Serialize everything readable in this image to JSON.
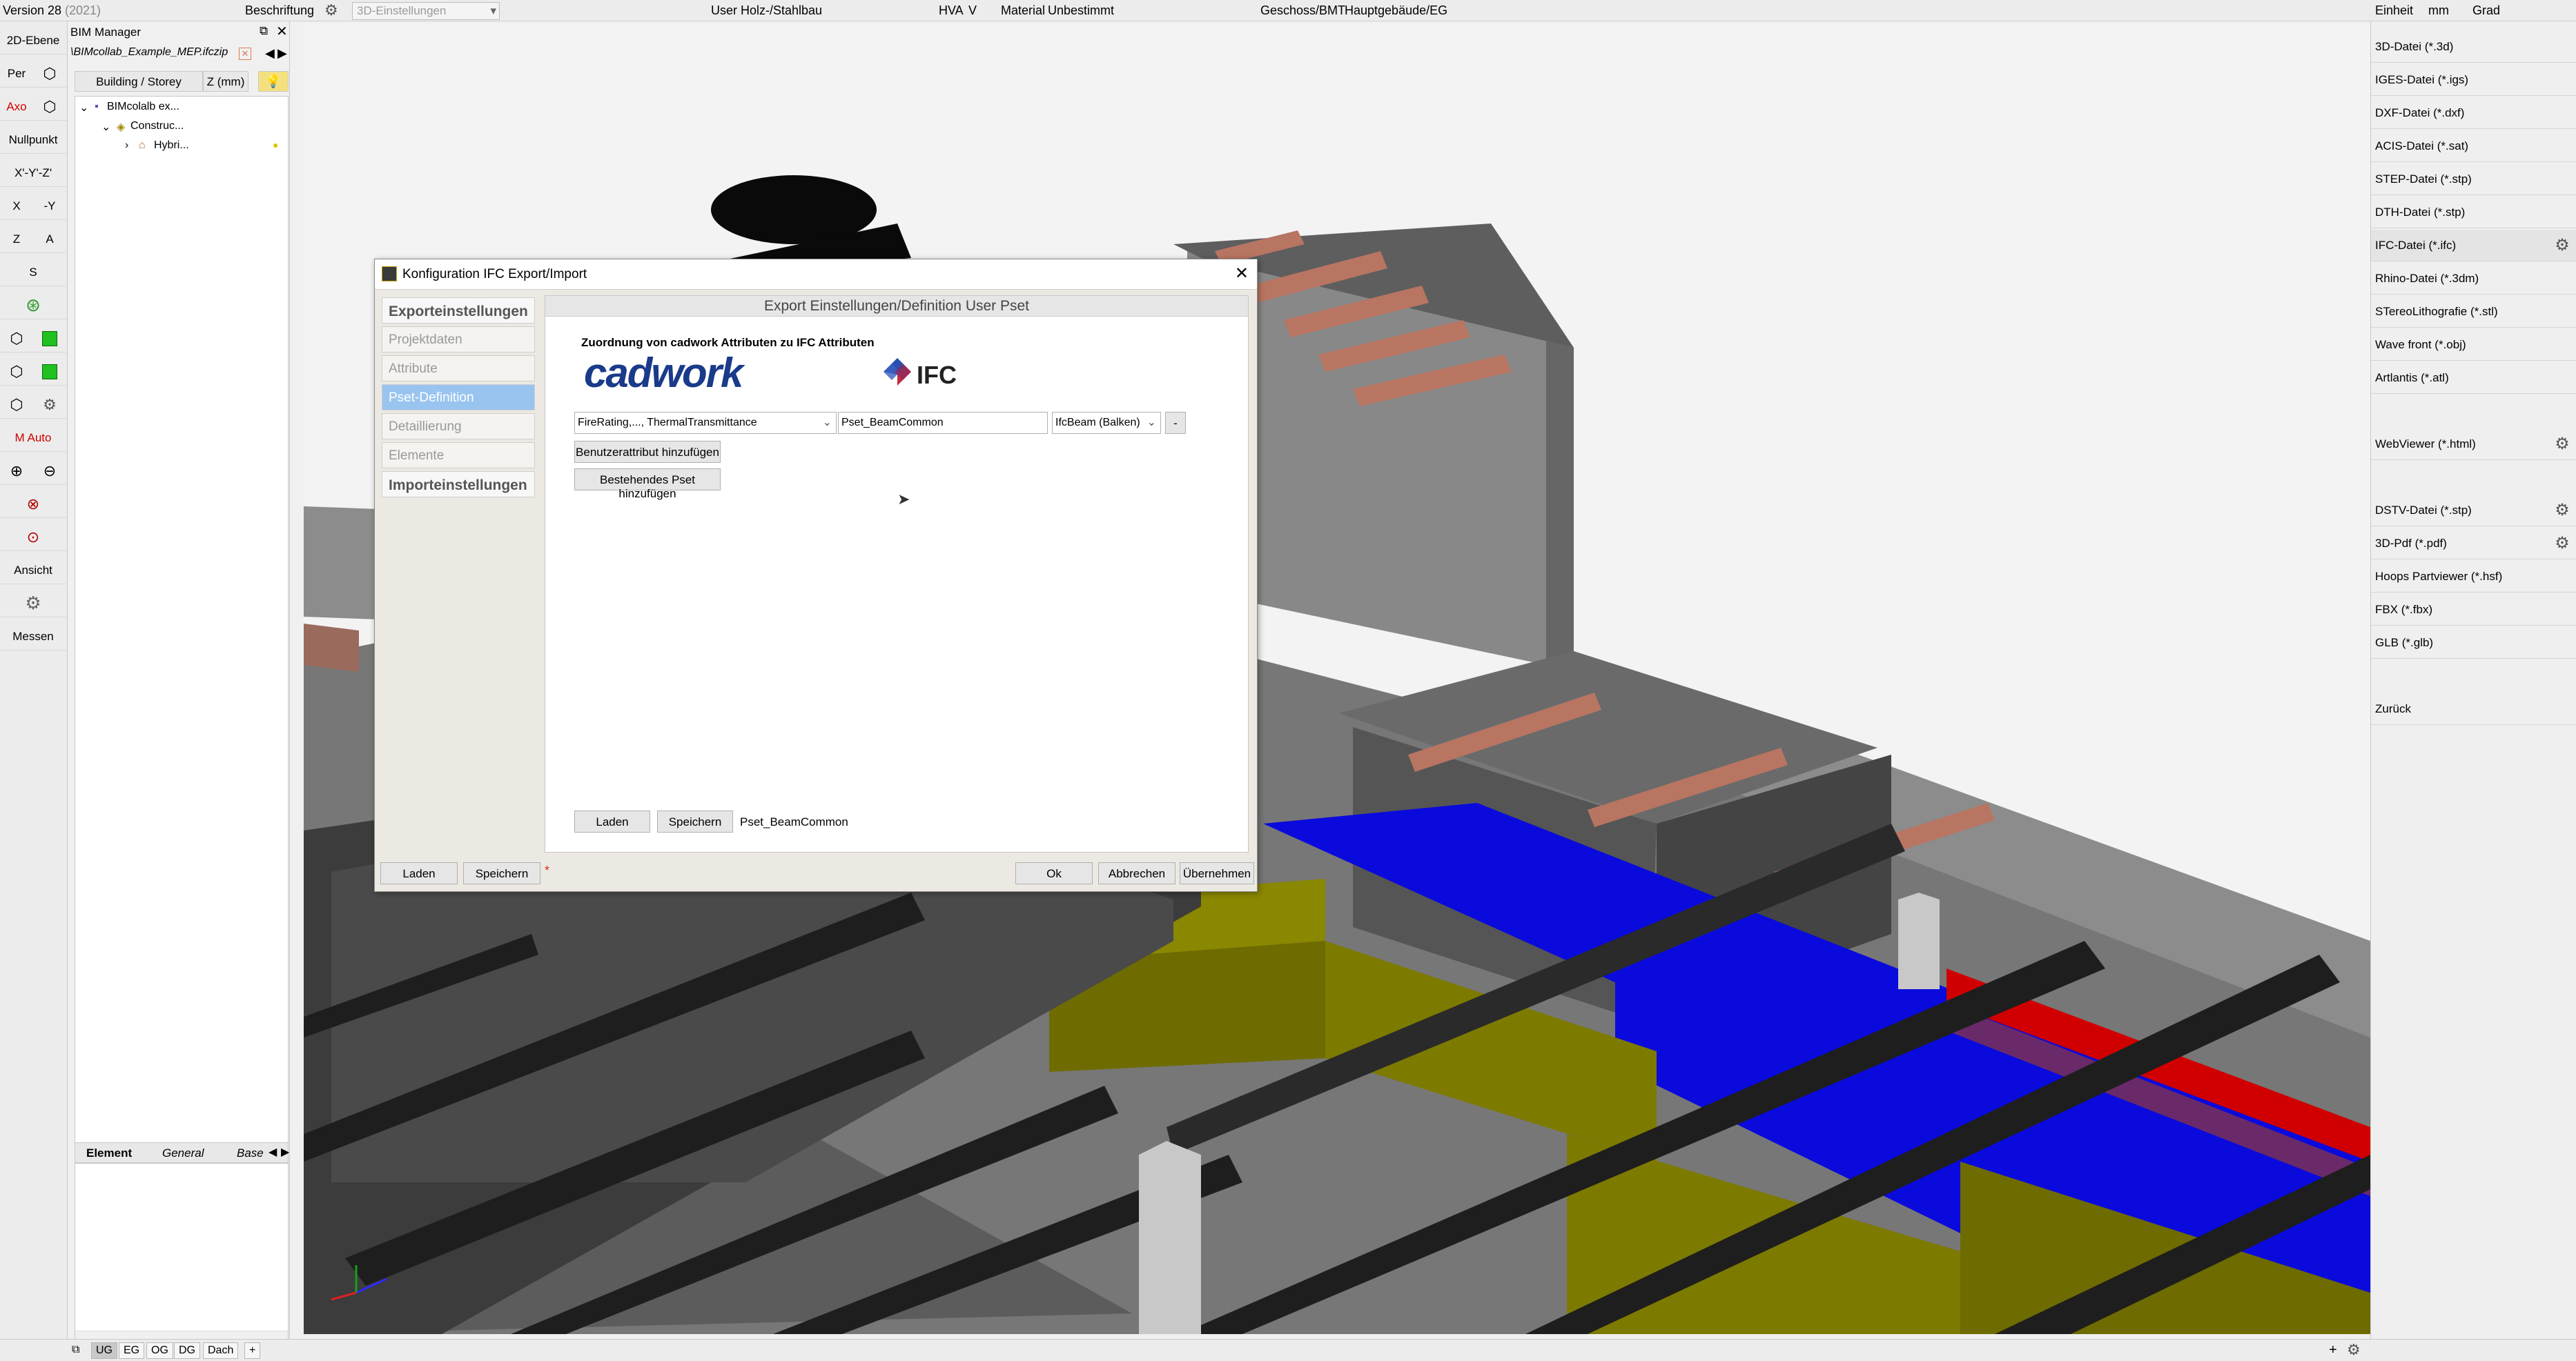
{
  "topbar": {
    "version": "Version 28",
    "year": "(2021)",
    "beschriftung": "Beschriftung",
    "view_settings": "3D-Einstellungen",
    "user_label": "User",
    "user_value": "Holz-/Stahlbau",
    "hva": "HVA",
    "v": "V",
    "material_label": "Material",
    "material_value": "Unbestimmt",
    "geschoss_label": "Geschoss/BMT",
    "geschoss_value": "Hauptgebäude/EG",
    "einheit_label": "Einheit",
    "einheit_mm": "mm",
    "einheit_grad": "Grad"
  },
  "left_toolbar": {
    "ebene": "2D-Ebene",
    "per": "Per",
    "axo": "Axo",
    "nullpunkt": "Nullpunkt",
    "xyz": "X'-Y'-Z'",
    "x": "X",
    "minus_y": "-Y",
    "z": "Z",
    "a": "A",
    "s": "S",
    "m_auto": "M Auto",
    "ansicht": "Ansicht",
    "messen": "Messen"
  },
  "bim_manager": {
    "title": "BIM Manager",
    "file": "\\BIMcollab_Example_MEP.ifczip",
    "col1": "Building / Storey",
    "col2": "Z (mm)",
    "tree": [
      "BIMcolalb ex...",
      "Construc...",
      "Hybri..."
    ],
    "bottom_tabs": [
      "Element",
      "General",
      "Base"
    ]
  },
  "dialog": {
    "title": "Konfiguration IFC Export/Import",
    "nav": [
      "Exporteinstellungen",
      "Projektdaten",
      "Attribute",
      "Pset-Definition",
      "Detaillierung",
      "Elemente",
      "Importeinstellungen"
    ],
    "section_title": "Export Einstellungen/Definition User Pset",
    "subheading": "Zuordnung von cadwork Attributen zu IFC Attributen",
    "logo_cadwork": "cadwork",
    "logo_ifc": "IFC",
    "attr_select": "FireRating,..., ThermalTransmittance",
    "pset_name": "Pset_BeamCommon",
    "ifc_type": "IfcBeam (Balken)",
    "remove_btn": "-",
    "add_user_attr": "Benutzerattribut hinzufügen",
    "add_existing_pset": "Bestehendes Pset hinzufügen",
    "laden": "Laden",
    "speichern": "Speichern",
    "pset_current": "Pset_BeamCommon",
    "footer_laden": "Laden",
    "footer_speichern": "Speichern",
    "asterisk": "*",
    "ok": "Ok",
    "abbrechen": "Abbrechen",
    "uebernehmen": "Übernehmen"
  },
  "export_formats": [
    "3D-Datei (*.3d)",
    "IGES-Datei (*.igs)",
    "DXF-Datei (*.dxf)",
    "ACIS-Datei (*.sat)",
    "STEP-Datei (*.stp)",
    "DTH-Datei (*.stp)",
    "IFC-Datei (*.ifc)",
    "Rhino-Datei (*.3dm)",
    "STereoLithografie (*.stl)",
    "Wave front (*.obj)",
    "Artlantis (*.atl)",
    "WebViewer (*.html)",
    "DSTV-Datei (*.stp)",
    "3D-Pdf (*.pdf)",
    "Hoops Partviewer (*.hsf)",
    "FBX (*.fbx)",
    "GLB (*.glb)",
    "Zurück"
  ],
  "bottom_tabs": [
    "UG",
    "EG",
    "OG",
    "DG",
    "Dach",
    "+"
  ],
  "colors": {
    "selected_nav": "#99c4f0",
    "wall": "#6e6e6e",
    "blue_duct": "#0a0adc",
    "yellow_block": "#7d7a00",
    "beam_copper": "#b87562"
  }
}
